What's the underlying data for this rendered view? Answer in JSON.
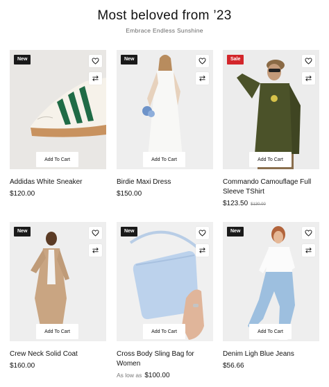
{
  "section": {
    "title": "Most beloved from ’23",
    "subtitle": "Embrace Endless Sunshine"
  },
  "products": [
    {
      "badge": "New",
      "badge_type": "new",
      "name": "Addidas White Sneaker",
      "price": "$120.00",
      "add_to_cart": "Add To Cart",
      "image": "white sneaker with green stripes"
    },
    {
      "badge": "New",
      "badge_type": "new",
      "name": "Birdie Maxi Dress",
      "price": "$150.00",
      "add_to_cart": "Add To Cart",
      "image": "woman in white maxi dress holding flowers"
    },
    {
      "badge": "Sale",
      "badge_type": "sale",
      "name": "Commando Camouflage Full Sleeve TShirt",
      "price": "$123.50",
      "old_price": "$130.00",
      "add_to_cart": "Add To Cart",
      "image": "man in olive long sleeve t-shirt with bucket hat"
    },
    {
      "badge": "New",
      "badge_type": "new",
      "name": "Crew Neck Solid Coat",
      "price": "$160.00",
      "add_to_cart": "Add To Cart",
      "image": "man in beige coat"
    },
    {
      "badge": "New",
      "badge_type": "new",
      "name": "Cross Body Sling Bag for Women",
      "price_prefix": "As low as",
      "price": "$100.00",
      "add_to_cart": "Add To Cart",
      "image": "light blue sling bag in hand"
    },
    {
      "badge": "New",
      "badge_type": "new",
      "name": "Denim Ligh Blue Jeans",
      "price": "$56.66",
      "add_to_cart": "Add To Cart",
      "image": "woman in light blue jeans and white t-shirt"
    }
  ],
  "colors": {
    "badge_new": "#1a1a1a",
    "badge_sale": "#d3262b",
    "text": "#111111"
  },
  "icons": {
    "wishlist": "heart-icon",
    "compare": "compare-arrows-icon"
  }
}
